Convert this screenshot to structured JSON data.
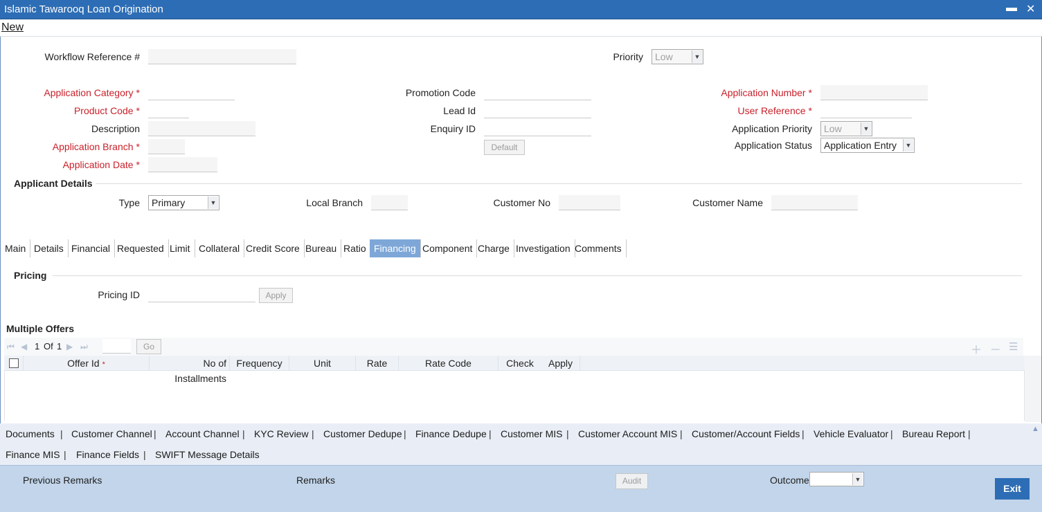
{
  "window": {
    "title": "Islamic Tawarooq Loan Origination",
    "minimize": "▬",
    "close": "✕"
  },
  "menu": {
    "new": "New"
  },
  "header": {
    "workflow_ref_label": "Workflow Reference #",
    "priority_label": "Priority",
    "priority_value": "Low"
  },
  "app": {
    "category_label": "Application Category",
    "product_code_label": "Product Code",
    "description_label": "Description",
    "branch_label": "Application Branch",
    "date_label": "Application Date",
    "promotion_code_label": "Promotion Code",
    "lead_id_label": "Lead Id",
    "enquiry_id_label": "Enquiry ID",
    "default_button": "Default",
    "app_number_label": "Application Number",
    "user_ref_label": "User Reference",
    "app_priority_label": "Application Priority",
    "app_priority_value": "Low",
    "app_status_label": "Application Status",
    "app_status_value": "Application Entry",
    "required_mark": "*"
  },
  "applicant": {
    "section_title": "Applicant Details",
    "type_label": "Type",
    "type_value": "Primary",
    "local_branch_label": "Local Branch",
    "customer_no_label": "Customer No",
    "customer_name_label": "Customer Name"
  },
  "tabs": [
    "Main",
    "Details",
    "Financial",
    "Requested",
    "Limit",
    "Collateral",
    "Credit Score",
    "Bureau",
    "Ratio",
    "Financing",
    "Component",
    "Charge",
    "Investigation",
    "Comments"
  ],
  "active_tab": "Financing",
  "pricing": {
    "section_title": "Pricing",
    "pricing_id_label": "Pricing ID",
    "apply_button": "Apply"
  },
  "offers": {
    "section_title": "Multiple Offers",
    "page_current": "1",
    "page_of": "Of",
    "page_total": "1",
    "go_button": "Go",
    "columns": [
      "Offer Id",
      "No of Installments",
      "Frequency",
      "Unit",
      "Rate",
      "Rate Code",
      "Check",
      "Apply"
    ]
  },
  "links_row1": [
    "Documents",
    "Customer Channel",
    "Account Channel",
    "KYC Review",
    "Customer Dedupe",
    "Finance Dedupe",
    "Customer MIS",
    "Customer Account MIS",
    "Customer/Account Fields",
    "Vehicle Evaluator",
    "Bureau Report"
  ],
  "links_row2": [
    "Finance MIS",
    "Finance Fields",
    "SWIFT Message Details"
  ],
  "separator": "|",
  "footer": {
    "previous_remarks": "Previous Remarks",
    "remarks": "Remarks",
    "audit_button": "Audit",
    "outcome_label": "Outcome",
    "exit_button": "Exit"
  }
}
